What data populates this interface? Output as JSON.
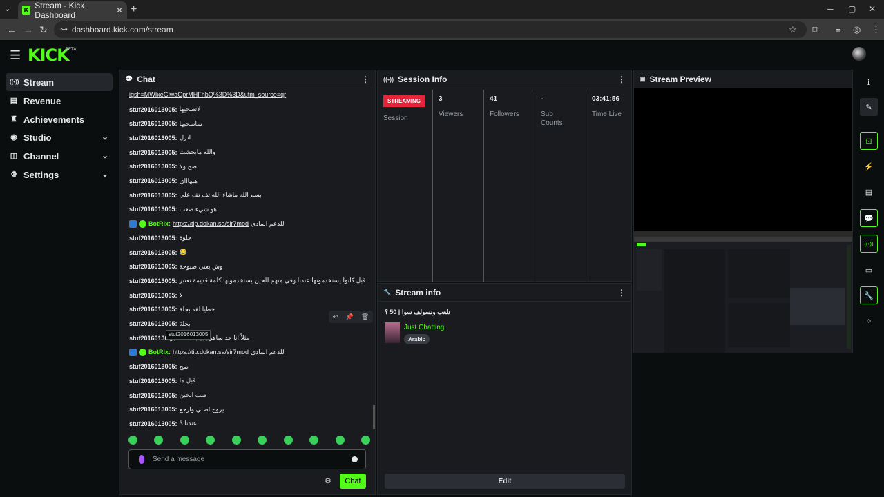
{
  "browser": {
    "tab_title": "Stream - Kick Dashboard",
    "tab_list_icon": "chevron-down-icon",
    "new_tab": "+",
    "url": "dashboard.kick.com/stream"
  },
  "app": {
    "logo": "KICK",
    "beta": "BETA"
  },
  "sidebar": {
    "items": [
      {
        "label": "Stream",
        "icon": "((•))"
      },
      {
        "label": "Revenue",
        "icon": "▤"
      },
      {
        "label": "Achievements",
        "icon": "🏆"
      },
      {
        "label": "Studio",
        "icon": "◉"
      },
      {
        "label": "Channel",
        "icon": "◫"
      },
      {
        "label": "Settings",
        "icon": "⚙"
      }
    ]
  },
  "chat": {
    "title": "Chat",
    "top_link": "igsh=MWIxeGlwaGprMHFhbQ%3D%3D&utm_source=qr",
    "messages": [
      {
        "user": "stuf2016013005:",
        "text": "لاتصحيها"
      },
      {
        "user": "stuf2016013005:",
        "text": "ساسحبها"
      },
      {
        "user": "stuf2016013005:",
        "text": "انزل"
      },
      {
        "user": "stuf2016013005:",
        "text": "والله مابحشت"
      },
      {
        "user": "stuf2016013005:",
        "text": "صح ولا"
      },
      {
        "user": "stuf2016013005:",
        "text": "هيهاااي"
      },
      {
        "user": "stuf2016013005:",
        "text": "بسم الله ماشاء الله تف تف علي"
      },
      {
        "user": "stuf2016013005:",
        "text": "هو شيء صعب"
      },
      {
        "user": "BotRix:",
        "text": "للدعم المادي",
        "link": "https://tip.dokan.sa/sir7mod",
        "bot": true
      },
      {
        "user": "stuf2016013005:",
        "text": "حلوة"
      },
      {
        "user": "stuf2016013005:",
        "text": "😂"
      },
      {
        "user": "stuf2016013005:",
        "text": "وش يعني صبوحة"
      },
      {
        "user": "stuf2016013005:",
        "text": "قبل كانوا يستخدمونها عندنا وفي منهم للحين يستخدمونها كلمة قديمة تعتبر"
      },
      {
        "user": "stuf2016013005:",
        "text": "لا"
      },
      {
        "user": "stuf2016013005:",
        "text": "خطيا لقد بجلة"
      },
      {
        "user": "stuf2016013005:",
        "text": "بجلة"
      },
      {
        "user": "stuf20160130",
        "text": "مثلاً انا حد ساهر يجيب معه صبو"
      },
      {
        "user": "BotRix:",
        "text": "للدعم المادي",
        "link": "https://tip.dokan.sa/sir7mod",
        "bot": true
      },
      {
        "user": "stuf2016013005:",
        "text": "صح"
      },
      {
        "user": "stuf2016013005:",
        "text": "قبل ما"
      },
      {
        "user": "stuf2016013005:",
        "text": "صب الحين"
      },
      {
        "user": "stuf2016013005:",
        "text": "يروح اصلي وارجع"
      },
      {
        "user": "stuf2016013005:",
        "text": "3 عندنا"
      }
    ],
    "tooltip": "stuf2016013005",
    "input_placeholder": "Send a message",
    "send_label": "Chat"
  },
  "session": {
    "title": "Session Info",
    "status": "STREAMING",
    "status_label": "Session",
    "stats": [
      {
        "value": "3",
        "label": "Viewers"
      },
      {
        "value": "41",
        "label": "Followers"
      },
      {
        "value": "-",
        "label": "Sub Counts"
      },
      {
        "value": "03:41:56",
        "label": "Time Live"
      }
    ]
  },
  "stream_info": {
    "title": "Stream info",
    "stream_title": "نلعب ونسولف سوا | 50 ؟",
    "category": "Just Chatting",
    "language": "Arabic",
    "edit_label": "Edit"
  },
  "preview": {
    "title": "Stream Preview"
  },
  "colors": {
    "accent": "#53fc18",
    "live": "#e5243b",
    "panel": "#191b1f",
    "background": "#0b0e0f"
  }
}
